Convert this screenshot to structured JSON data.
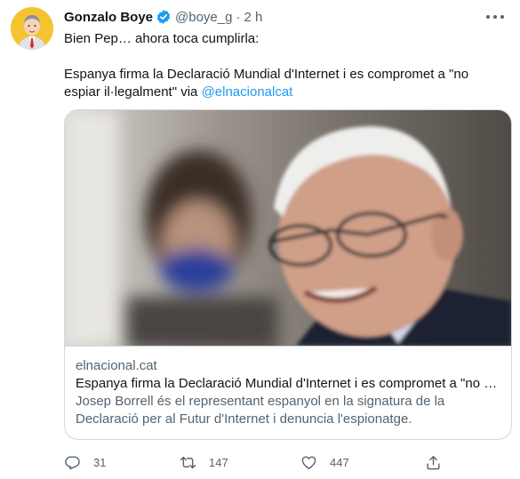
{
  "author": {
    "name": "Gonzalo Boye",
    "handle": "@boye_g",
    "separator": "·",
    "time": "2 h"
  },
  "tweet": {
    "line1": "Bien Pep… ahora toca cumplirla:",
    "line2_text": "Espanya firma la Declaració Mundial d'Internet i es compromet a \"no espiar il·legalment\" via ",
    "line2_mention": "@elnacionalcat"
  },
  "card": {
    "domain": "elnacional.cat",
    "title": "Espanya firma la Declaració Mundial d'Internet i es compromet a \"no espiar il·legalment\"",
    "description": "Josep Borrell és el representant espanyol en la signatura de la Declaració per al Futur d'Internet i denuncia l'espionatge."
  },
  "actions": {
    "replies": "31",
    "retweets": "147",
    "likes": "447"
  },
  "colors": {
    "accent": "#1d9bf0",
    "muted": "#536471",
    "border": "#cfd9de",
    "avatar_bg": "#f4c430"
  },
  "icons": {
    "verified": "verified-badge-icon",
    "reply": "reply-icon",
    "retweet": "retweet-icon",
    "like": "heart-icon",
    "share": "share-icon",
    "more": "more-icon"
  }
}
